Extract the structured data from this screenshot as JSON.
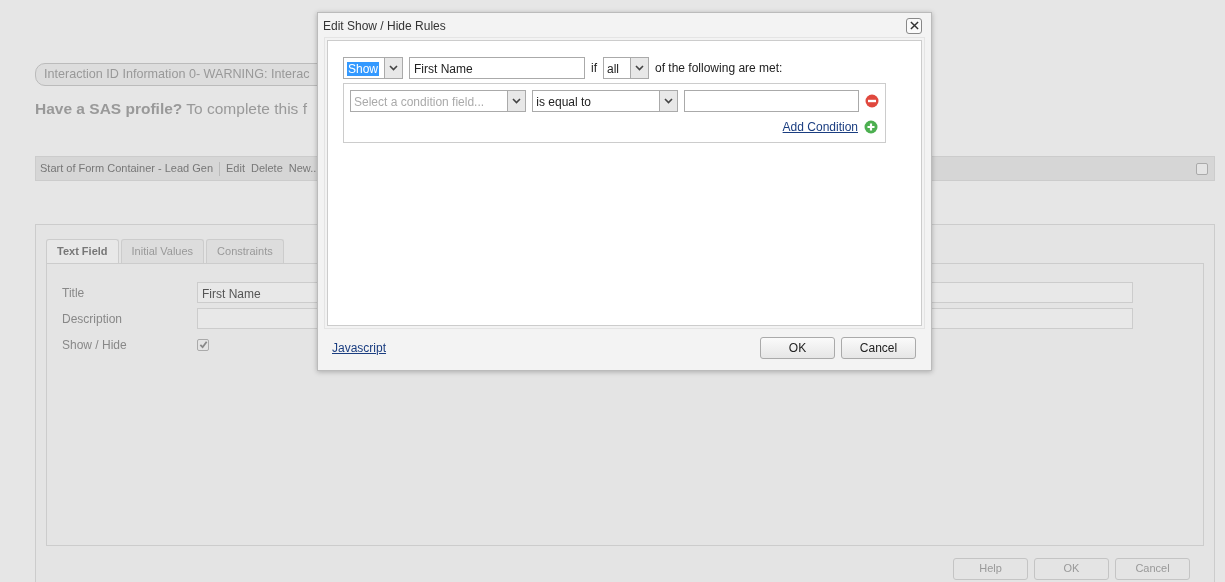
{
  "background": {
    "info_pill": "Interaction ID Information 0- WARNING: Interac",
    "heading": "**Have a SAS profile?** To complete this f",
    "toolbar": {
      "title": "Start of Form Container - Lead Gen",
      "actions": [
        "Edit",
        "Delete",
        "New.."
      ],
      "checkbox": {
        "checked": false
      }
    },
    "panel": {
      "tabs": [
        {
          "label": "Text Field",
          "selected": true
        },
        {
          "label": "Initial Values",
          "selected": false
        },
        {
          "label": "Constraints",
          "selected": false
        }
      ],
      "fields": [
        {
          "kind": "text",
          "label": "Title",
          "value": "First Name"
        },
        {
          "kind": "text",
          "label": "Description"
        },
        {
          "kind": "checkbox",
          "label": "Show / Hide",
          "checked": true
        }
      ],
      "buttons": [
        "Help",
        "OK",
        "Cancel"
      ]
    }
  },
  "dialog": {
    "title": "Edit Show / Hide Rules",
    "rule": {
      "action": {
        "value": "Show",
        "text_selected": true
      },
      "target": "First Name",
      "if_label": "if",
      "match": {
        "value": "all"
      },
      "suffix": "of the following are met:"
    },
    "conditions": [
      {
        "field": {
          "placeholder": "Select a condition field..."
        },
        "operator": {
          "value": "is equal to"
        }
      }
    ],
    "add_condition": "Add Condition",
    "javascript_link": "Javascript",
    "buttons": [
      "OK",
      "Cancel"
    ]
  }
}
